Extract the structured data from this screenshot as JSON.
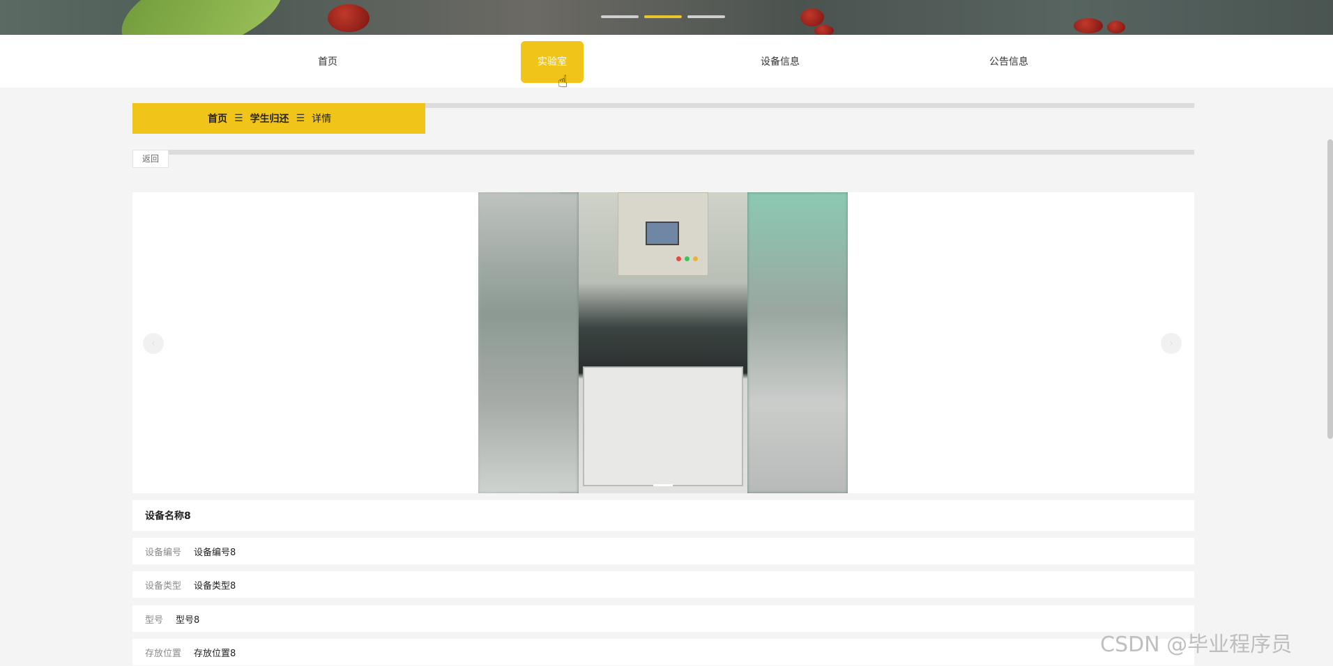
{
  "banner": {
    "indicators": 3,
    "active_index": 1
  },
  "nav": {
    "items": [
      {
        "label": "首页"
      },
      {
        "label": "实验室"
      },
      {
        "label": "设备信息"
      },
      {
        "label": "公告信息"
      }
    ],
    "active": "实验室"
  },
  "breadcrumb": {
    "home": "首页",
    "section": "学生归还",
    "current": "详情",
    "separator": "☰"
  },
  "back_label": "返回",
  "device": {
    "name": "设备名称8",
    "fields": [
      {
        "label": "设备编号",
        "value": "设备编号8"
      },
      {
        "label": "设备类型",
        "value": "设备类型8"
      },
      {
        "label": "型号",
        "value": "型号8"
      },
      {
        "label": "存放位置",
        "value": "存放位置8"
      }
    ]
  },
  "carousel": {
    "prev_icon": "chevron-left-icon",
    "next_icon": "chevron-right-icon"
  },
  "watermark": "CSDN @毕业程序员",
  "colors": {
    "accent": "#f0c419",
    "background": "#f4f4f4"
  }
}
